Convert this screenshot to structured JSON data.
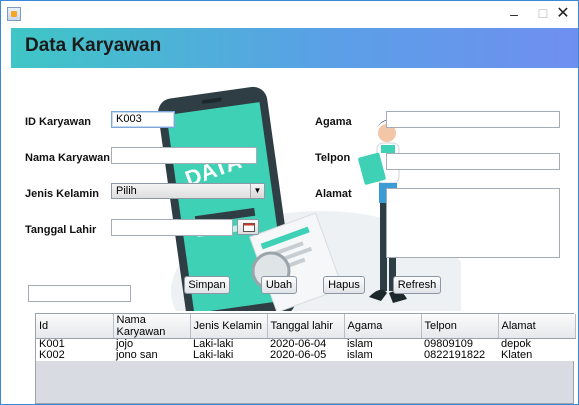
{
  "window": {
    "title": "",
    "minimize_glyph": "–",
    "maximize_glyph": "☐",
    "close_glyph": "✕"
  },
  "header": {
    "title": "Data Karyawan"
  },
  "form": {
    "id_label": "ID Karyawan",
    "id_value": "K003",
    "nama_label": "Nama Karyawan",
    "nama_value": "",
    "jk_label": "Jenis Kelamin",
    "jk_selected": "Pilih",
    "tgl_label": "Tanggal Lahir",
    "tgl_value": "",
    "agama_label": "Agama",
    "agama_value": "",
    "telpon_label": "Telpon",
    "telpon_value": "",
    "alamat_label": "Alamat",
    "alamat_value": "",
    "search_value": ""
  },
  "buttons": {
    "simpan": "Simpan",
    "ubah": "Ubah",
    "hapus": "Hapus",
    "refresh": "Refresh"
  },
  "table": {
    "columns": [
      "Id",
      "Nama Karyawan",
      "Jenis Kelamin",
      "Tanggal lahir",
      "Agama",
      "Telpon",
      "Alamat"
    ],
    "rows": [
      [
        "K001",
        "jojo",
        "Laki-laki",
        "2020-06-04",
        "islam",
        "09809109",
        "depok"
      ],
      [
        "K002",
        "jono san",
        "Laki-laki",
        "2020-06-05",
        "islam",
        "0822191822",
        "Klaten"
      ]
    ]
  },
  "colors": {
    "header_start": "#3fc6c6",
    "header_end": "#6f8ff0",
    "illustration_teal": "#3fd1b5",
    "illustration_dark": "#2f3e44"
  },
  "icons": {
    "date_picker": "calendar-icon",
    "combo_arrow": "chevron-down-icon"
  }
}
